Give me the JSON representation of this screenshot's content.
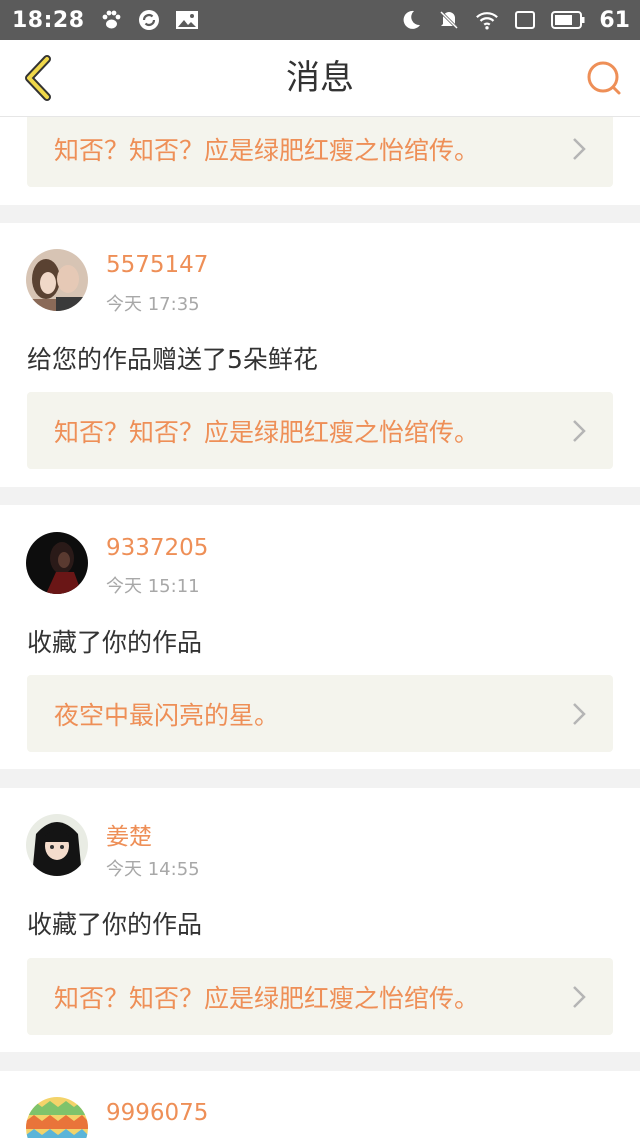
{
  "status_bar": {
    "time": "18:28",
    "battery": "61",
    "left_icons": [
      "paw-icon",
      "sync-icon",
      "image-icon"
    ],
    "right_icons": [
      "moon-icon",
      "mute-icon",
      "wifi-icon",
      "screen-icon",
      "battery-icon"
    ]
  },
  "nav": {
    "title": "消息",
    "back_icon": "chevron-left-icon",
    "search_icon": "search-icon",
    "accent": "#ee8f57"
  },
  "items": [
    {
      "work_title": "知否？知否？应是绿肥红瘦之怡绾传。"
    },
    {
      "username": "5575147",
      "time": "今天 17:35",
      "message": "给您的作品赠送了5朵鲜花",
      "work_title": "知否？知否？应是绿肥红瘦之怡绾传。"
    },
    {
      "username": "9337205",
      "time": "今天 15:11",
      "message": "收藏了你的作品",
      "work_title": "夜空中最闪亮的星。"
    },
    {
      "username": "姜楚",
      "time": "今天 14:55",
      "message": "收藏了你的作品",
      "work_title": "知否？知否？应是绿肥红瘦之怡绾传。"
    },
    {
      "username": "9996075"
    }
  ]
}
